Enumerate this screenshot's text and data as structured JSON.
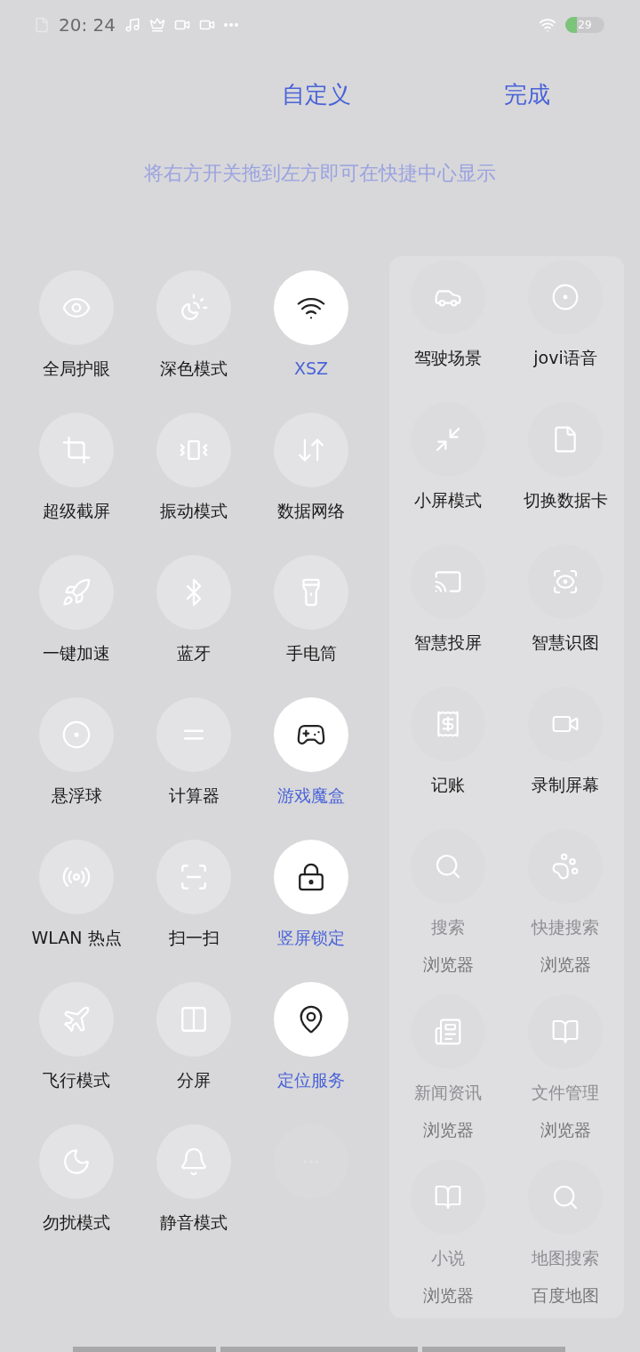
{
  "status_bar": {
    "time": "20: 24",
    "battery": "29"
  },
  "header": {
    "title": "自定义",
    "done": "完成"
  },
  "hint": "将右方开关拖到左方即可在快捷中心显示",
  "active_tiles": [
    {
      "kind": "toggle",
      "label": "全局护眼",
      "on": false
    },
    {
      "kind": "toggle",
      "label": "深色模式",
      "on": false
    },
    {
      "kind": "toggle",
      "label": "XSZ",
      "on": true
    },
    {
      "kind": "toggle",
      "label": "超级截屏",
      "on": false
    },
    {
      "kind": "toggle",
      "label": "振动模式",
      "on": false
    },
    {
      "kind": "toggle",
      "label": "数据网络",
      "on": false
    },
    {
      "kind": "toggle",
      "label": "一键加速",
      "on": false
    },
    {
      "kind": "toggle",
      "label": "蓝牙",
      "on": false
    },
    {
      "kind": "toggle",
      "label": "手电筒",
      "on": false
    },
    {
      "kind": "toggle",
      "label": "悬浮球",
      "on": false
    },
    {
      "kind": "toggle",
      "label": "计算器",
      "on": false
    },
    {
      "kind": "toggle",
      "label": "游戏魔盒",
      "on": true
    },
    {
      "kind": "toggle",
      "label": "WLAN 热点",
      "on": false
    },
    {
      "kind": "toggle",
      "label": "扫一扫",
      "on": false
    },
    {
      "kind": "toggle",
      "label": "竖屏锁定",
      "on": true
    },
    {
      "kind": "toggle",
      "label": "飞行模式",
      "on": false
    },
    {
      "kind": "toggle",
      "label": "分屏",
      "on": false
    },
    {
      "kind": "toggle",
      "label": "定位服务",
      "on": true
    },
    {
      "kind": "toggle",
      "label": "勿扰模式",
      "on": false
    },
    {
      "kind": "toggle",
      "label": "静音模式",
      "on": false
    },
    {
      "kind": "empty"
    }
  ],
  "available_tiles": [
    {
      "label": "驾驶场景"
    },
    {
      "label": "jovi语音"
    },
    {
      "label": "小屏模式"
    },
    {
      "label": "切换数据卡"
    },
    {
      "label": "智慧投屏"
    },
    {
      "label": "智慧识图"
    },
    {
      "label": "记账"
    },
    {
      "label": "录制屏幕"
    },
    {
      "label": "搜索",
      "app": "浏览器"
    },
    {
      "label": "快捷搜索",
      "app": "浏览器"
    },
    {
      "label": "新闻资讯",
      "app": "浏览器"
    },
    {
      "label": "文件管理",
      "app": "浏览器"
    },
    {
      "label": "小说",
      "app": "浏览器"
    },
    {
      "label": "地图搜索",
      "app": "百度地图"
    }
  ]
}
